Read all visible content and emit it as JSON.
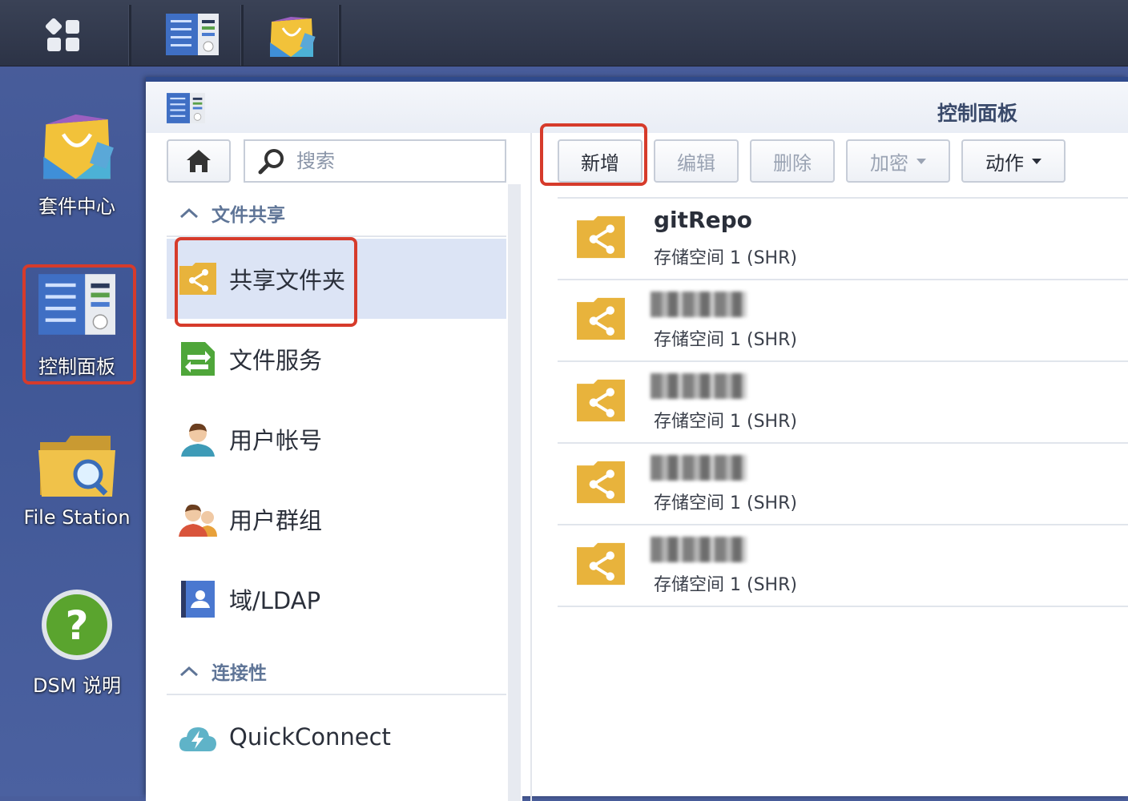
{
  "desktop": {
    "items": [
      {
        "label": "套件中心",
        "icon": "package-center-icon"
      },
      {
        "label": "控制面板",
        "icon": "control-panel-icon"
      },
      {
        "label": "File Station",
        "icon": "file-station-icon"
      },
      {
        "label": "DSM 说明",
        "icon": "help-icon"
      }
    ]
  },
  "taskbar": {
    "items": [
      "main-menu-icon",
      "control-panel-icon",
      "package-center-icon"
    ]
  },
  "window": {
    "title": "控制面板"
  },
  "search": {
    "placeholder": "搜索"
  },
  "sidebar": {
    "sections": [
      {
        "title": "文件共享",
        "items": [
          {
            "label": "共享文件夹",
            "icon": "shared-folder-icon",
            "active": true
          },
          {
            "label": "文件服务",
            "icon": "file-services-icon"
          },
          {
            "label": "用户帐号",
            "icon": "user-icon"
          },
          {
            "label": "用户群组",
            "icon": "group-icon"
          },
          {
            "label": "域/LDAP",
            "icon": "ldap-icon"
          }
        ]
      },
      {
        "title": "连接性",
        "items": [
          {
            "label": "QuickConnect",
            "icon": "quickconnect-icon"
          }
        ]
      }
    ]
  },
  "toolbar": {
    "create": "新增",
    "edit": "编辑",
    "delete": "删除",
    "encrypt": "加密",
    "action": "动作"
  },
  "shared_folders": [
    {
      "name": "gitRepo",
      "location": "存储空间 1 (SHR)"
    },
    {
      "name": "",
      "location": "存储空间 1 (SHR)"
    },
    {
      "name": "",
      "location": "存储空间 1 (SHR)"
    },
    {
      "name": "",
      "location": "存储空间 1 (SHR)"
    },
    {
      "name": "",
      "location": "存储空间 1 (SHR)"
    }
  ],
  "colors": {
    "accent": "#2f4a8c",
    "highlight": "#d63b2b",
    "folder": "#e8b33c",
    "active_row": "#dce4f5"
  }
}
